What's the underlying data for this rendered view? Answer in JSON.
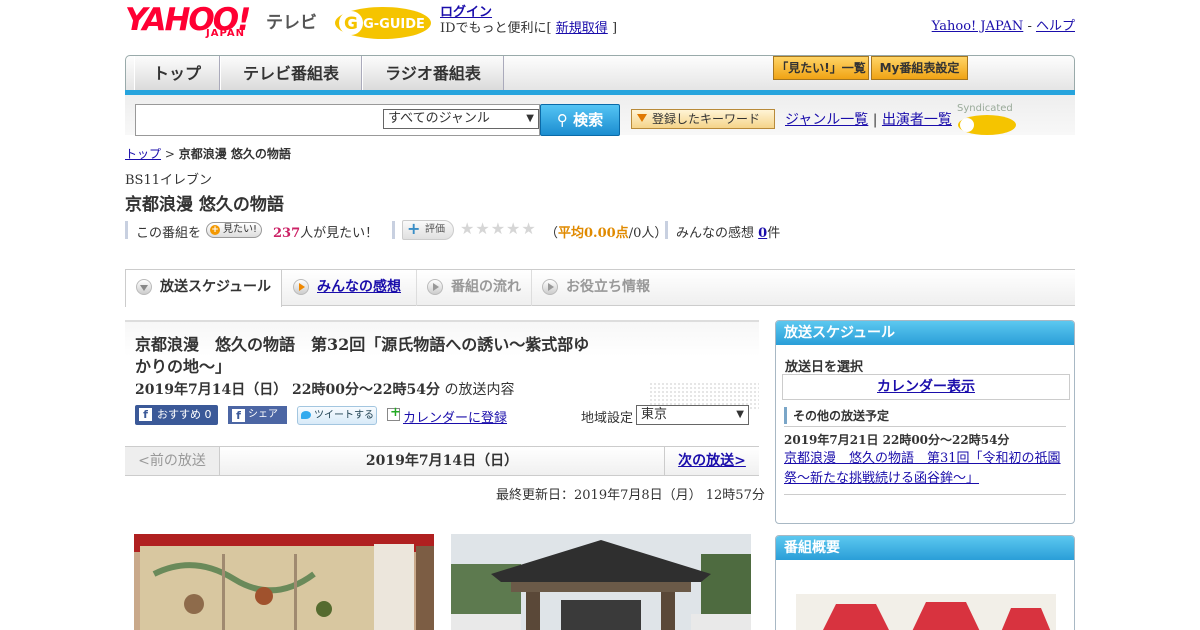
{
  "header": {
    "logo_yahoo": "YAHOO!",
    "logo_japan": "JAPAN",
    "logo_tv": "テレビ",
    "gguide_logo": "G-GUIDE",
    "login": "ログイン",
    "login_sub_prefix": "IDでもっと便利に[",
    "register": "新規取得",
    "login_sub_suffix": "]",
    "yahoo_japan": "Yahoo! JAPAN",
    "separator": "-",
    "help": "ヘルプ"
  },
  "nav": {
    "tabs": [
      "トップ",
      "テレビ番組表",
      "ラジオ番組表"
    ],
    "mitai_list": "「見たい!」一覧",
    "my_settings": "My番組表設定"
  },
  "search": {
    "genre": "すべてのジャンル",
    "button": "検索",
    "keyword_button": "登録したキーワード",
    "genre_list": "ジャンル一覧",
    "pipe": "|",
    "performer_list": "出演者一覧",
    "syndicated": "Syndicated"
  },
  "breadcrumb": {
    "top": "トップ",
    "sep": ">",
    "current": "京都浪漫 悠久の物語"
  },
  "program": {
    "channel": "BS11イレブン",
    "title": "京都浪漫 悠久の物語",
    "mitai_prefix": "この番組を",
    "mitai_btn": "見たい!",
    "mitai_count": "237",
    "mitai_suffix": "人が見たい！",
    "rating_btn": "評価",
    "stars": "★★★★★",
    "rating_open": "（",
    "rating_avg": "平均0.00点",
    "rating_count": "/0人）",
    "impressions_label": "みんなの感想",
    "impressions_count": "0",
    "impressions_unit": "件"
  },
  "tabs": [
    "放送スケジュール",
    "みんなの感想",
    "番組の流れ",
    "お役立ち情報"
  ],
  "episode": {
    "title": "京都浪漫　悠久の物語　第32回「源氏物語への誘い～紫式部ゆかりの地～」",
    "datetime": "2019年7月14日（日） 22時00分～22時54分",
    "datetime_suffix": "の放送内容",
    "fb_recommend": "おすすめ 0",
    "fb_share": "シェア",
    "tweet": "ツイートする",
    "calendar_register": "カレンダーに登録",
    "area_label": "地域設定",
    "area_value": "東京",
    "prev": "<前の放送",
    "current_date": "2019年7月14日（日）",
    "next": "次の放送>",
    "updated": "最終更新日：2019年7月8日（月） 12時57分"
  },
  "side": {
    "schedule_head": "放送スケジュール",
    "select_day": "放送日を選択",
    "calendar_show": "カレンダー表示",
    "other_head": "その他の放送予定",
    "other_time": "2019年7月21日 22時00分～22時54分",
    "other_link": "京都浪漫　悠久の物語　第31回「令和初の祇園祭～新たな挑戦続ける函谷鉾～」",
    "summary_head": "番組概要"
  },
  "colors": {
    "accent_blue": "#27a4dd",
    "yahoo_red": "#ff0033",
    "link": "#1a0dab"
  }
}
